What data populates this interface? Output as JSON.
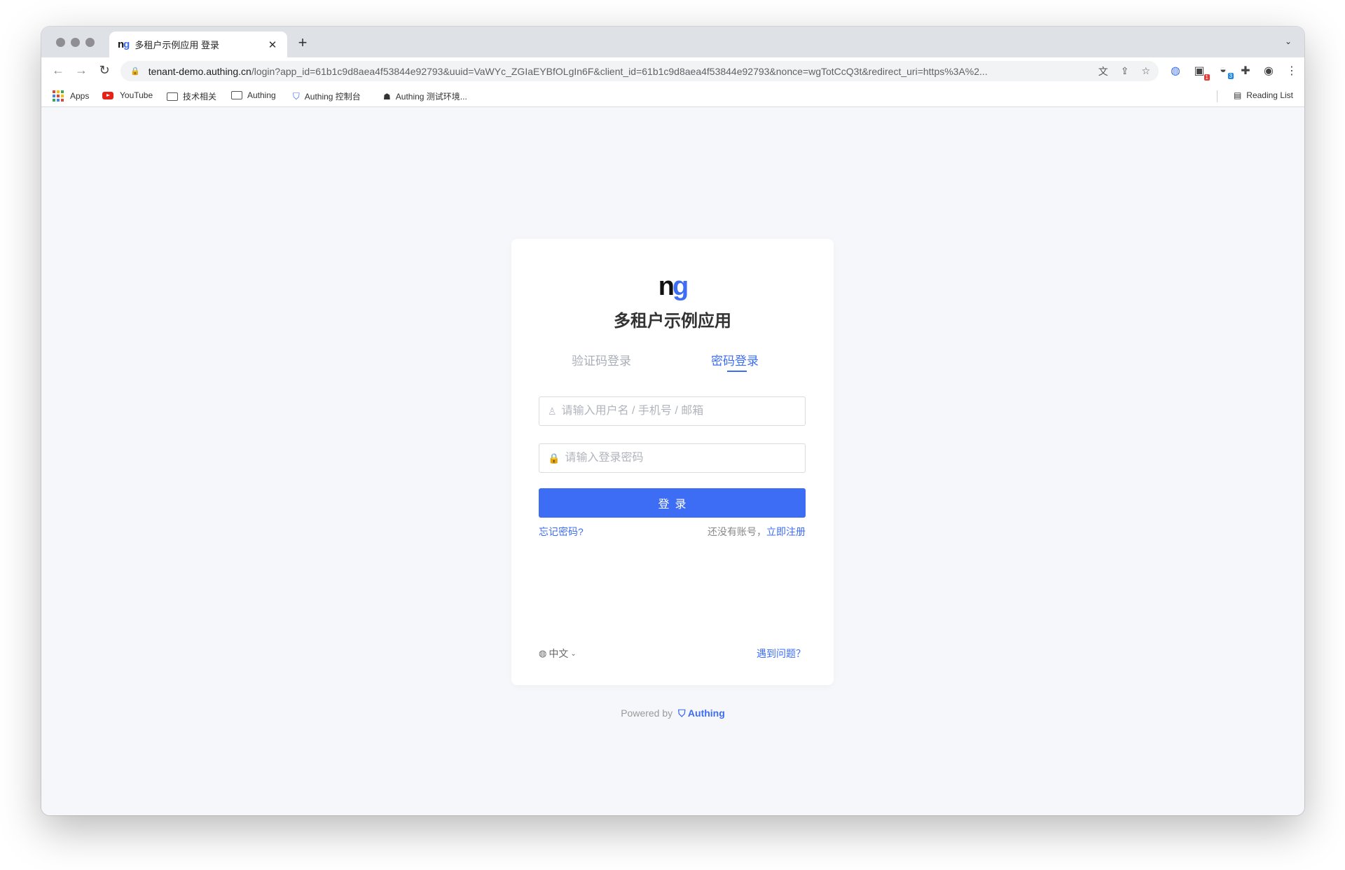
{
  "browser": {
    "tab_title": "多租户示例应用 登录",
    "tab_favicon": "ng",
    "url_host": "tenant-demo.authing.cn",
    "url_path": "/login?app_id=61b1c9d8aea4f53844e92793&uuid=VaWYc_ZGIaEYBfOLgIn6F&client_id=61b1c9d8aea4f53844e92793&nonce=wgTotCcQ3t&redirect_uri=https%3A%2...",
    "new_tab_label": "+",
    "extension_badges": [
      "1",
      "3"
    ]
  },
  "bookmarks": {
    "items": [
      {
        "label": "Apps",
        "icon": "apps-grid-icon"
      },
      {
        "label": "YouTube",
        "icon": "youtube-icon"
      },
      {
        "label": "技术相关",
        "icon": "folder-icon"
      },
      {
        "label": "Authing",
        "icon": "folder-icon"
      },
      {
        "label": "Authing 控制台",
        "icon": "shield-icon"
      },
      {
        "label": "Authing 测试环境...",
        "icon": "robot-icon"
      }
    ],
    "reading_list": "Reading List"
  },
  "login": {
    "logo_text": "ng",
    "app_name": "多租户示例应用",
    "tabs": [
      "验证码登录",
      "密码登录"
    ],
    "active_tab": "密码登录",
    "username_placeholder": "请输入用户名 / 手机号 / 邮箱",
    "password_placeholder": "请输入登录密码",
    "submit_label": "登录",
    "forgot_password": "忘记密码?",
    "no_account": "还没有账号，",
    "register": "立即注册",
    "language": "中文",
    "help": "遇到问题？"
  },
  "footer": {
    "powered_by": "Powered by",
    "brand": "Authing"
  },
  "colors": {
    "accent": "#3d6cf5",
    "page_bg": "#f6f7fb",
    "card_bg": "#ffffff"
  }
}
